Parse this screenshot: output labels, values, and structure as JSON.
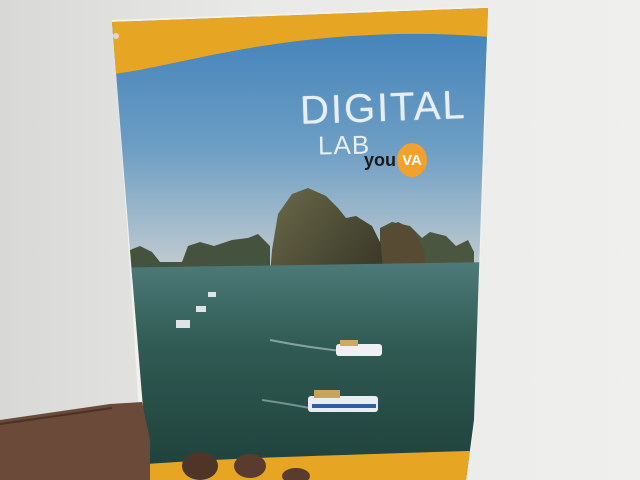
{
  "poster": {
    "title_line1": "DIGITAL",
    "title_line2": "LAB",
    "brand_part1": "you",
    "brand_part2": "VA"
  },
  "colors": {
    "wall": "#e8e8e6",
    "poster_band": "#e6a522",
    "sky_top": "#3c7fb8",
    "sky_bottom": "#b9c8d2",
    "sea": "#2f5a52",
    "brand_badge": "#f2a12c",
    "skin": "#6b4a3a"
  }
}
